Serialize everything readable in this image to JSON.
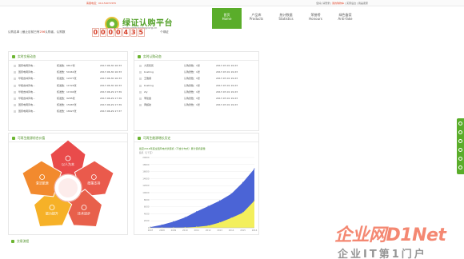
{
  "topbar": {
    "hotline": "客服电话：010-59071555",
    "links": "您好| 请登录 |",
    "cart": "我的购物车",
    "more": "| 买家后台 | 我是卖家"
  },
  "header": {
    "logo_title": "绿证认购平台",
    "logo_url": "www.greenenergy.org.cn"
  },
  "nav": [
    {
      "zh": "首页",
      "en": "Home"
    },
    {
      "zh": "产品库",
      "en": "Products"
    },
    {
      "zh": "统计数据",
      "en": "Statistics"
    },
    {
      "zh": "荣誉榜",
      "en": "Honours"
    },
    {
      "zh": "绿色备案",
      "en": "Anti-fake"
    }
  ],
  "counter": {
    "prefix": "认购名单 | 截止目前已有",
    "count_inline": "256",
    "suffix": "认购者，认购数",
    "digits": [
      "0",
      "0",
      "0",
      "0",
      "4",
      "3",
      "5"
    ],
    "tail": "个绿证"
  },
  "panel_trade": {
    "title": "实时交易动态",
    "rows": [
      {
        "name": "国家电网风电...",
        "amount": "核发数：6817张",
        "time": "2017-06-30 16:33"
      },
      {
        "name": "国家电网风电...",
        "amount": "核发数：50461张",
        "time": "2017-06-30 16:33"
      },
      {
        "name": "华能吉林风电...",
        "amount": "核发数：12077张",
        "time": "2017-06-30 16:33"
      },
      {
        "name": "华能吉林风电...",
        "amount": "核发数：11524张",
        "time": "2017-06-30 16:33"
      },
      {
        "name": "华能吉林风电...",
        "amount": "核发数：11540张",
        "time": "2017-06-29 17:39"
      },
      {
        "name": "华能吉林风电...",
        "amount": "核发数：9285张",
        "time": "2017-06-29 17:39"
      },
      {
        "name": "国家电网风电...",
        "amount": "核发数：15687张",
        "time": "2017-06-29 17:39"
      },
      {
        "name": "国家电网风电...",
        "amount": "核发数：18027张",
        "time": "2017-06-29 17:37"
      }
    ]
  },
  "panel_buy": {
    "title": "实时认购动态",
    "rows": [
      {
        "name": "大唐民民",
        "amount": "认购张数：1张",
        "time": "2017-07-01 19:23"
      },
      {
        "name": "boshing",
        "amount": "认购张数：1张",
        "time": "2017-07-01 19:23"
      },
      {
        "name": "王雅顺",
        "amount": "认购张数：1张",
        "time": "2017-07-01 19:23"
      },
      {
        "name": "boshing",
        "amount": "认购张数：1张",
        "time": "2017-07-01 19:23"
      },
      {
        "name": "zty",
        "amount": "认购张数：1张",
        "time": "2017-07-01 19:23"
      },
      {
        "name": "李建章",
        "amount": "认购张数：1张",
        "time": "2017-07-01 19:23"
      },
      {
        "name": "黄超航",
        "amount": "认购张数：1张",
        "time": "2017-07-01 19:23"
      }
    ]
  },
  "panel_value": {
    "title": "可再生能源综合价值",
    "center_label": "",
    "petals": [
      {
        "label": "以人为本",
        "color": "#e94b4b"
      },
      {
        "label": "政策支持",
        "color": "#ea5a4c"
      },
      {
        "label": "技术进步",
        "color": "#e8604b"
      },
      {
        "label": "能力提升",
        "color": "#f6b128"
      },
      {
        "label": "清洁能源",
        "color": "#f28a2e"
      }
    ]
  },
  "panel_growth": {
    "title": "可再生能源增长历史",
    "chart_title": "截至2016年底全国风电光伏装机（不含分布式）累计装机容量"
  },
  "chart_data": {
    "type": "area",
    "title": "截至2016年底全国风电光伏装机（不含分布式）累计装机容量",
    "ylabel": "装机（万千瓦）",
    "categories": [
      "2007",
      "2008",
      "2009",
      "2010",
      "2011",
      "2012",
      "2013",
      "2014",
      "2015",
      "2016"
    ],
    "ylim": [
      0,
      20000
    ],
    "yticks": [
      "20000",
      "18000",
      "16000",
      "14000",
      "12000",
      "10000",
      "8000",
      "6000",
      "4000",
      "2000",
      "0"
    ],
    "series": [
      {
        "name": "",
        "color": "#4b64d6",
        "values": [
          200,
          840,
          1760,
          2960,
          4620,
          6140,
          7710,
          9660,
          12900,
          16800
        ]
      },
      {
        "name": "",
        "color": "#f3ef5c",
        "values": [
          5,
          15,
          30,
          90,
          250,
          600,
          1500,
          2800,
          4300,
          7700
        ]
      }
    ],
    "grid": true
  },
  "bottom": {
    "title": "交易流程"
  },
  "watermark": {
    "main": "企业网D1Net",
    "sub": "企业IT第1门户"
  },
  "colors": {
    "brand": "#5aad2a",
    "counter_red": "#d53a23"
  },
  "rightbar_icons": [
    "globe-icon",
    "trophy-icon",
    "document-icon",
    "grid-icon",
    "user-icon",
    "arrow-up-icon"
  ]
}
